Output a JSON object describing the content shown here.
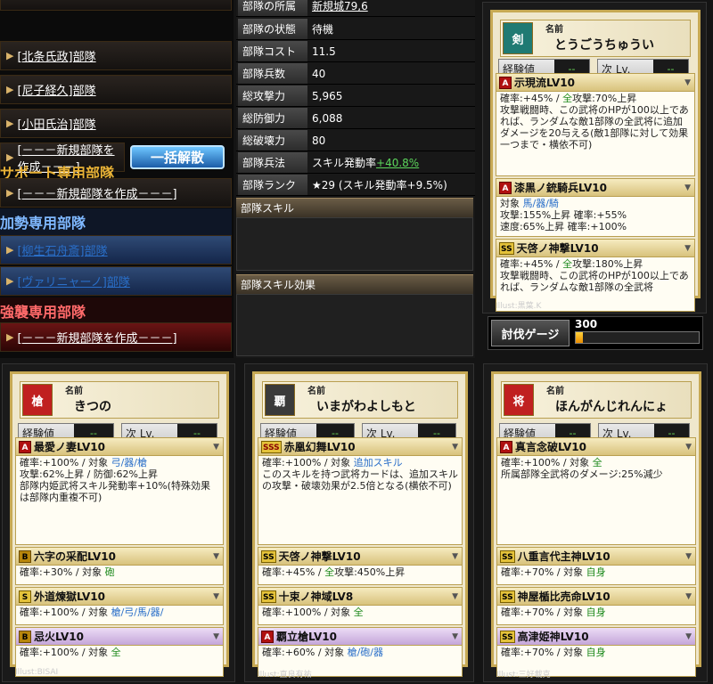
{
  "left_panel": {
    "rows_top": [
      {
        "label": "[北条氏政]部隊"
      },
      {
        "label": "[尼子経久]部隊"
      },
      {
        "label": "[小田氏治]部隊"
      },
      {
        "label": "[－－－新規部隊を作成－－－]"
      }
    ],
    "bulk_button": "一括解散",
    "support_section": "サポート専用部隊",
    "support_rows": [
      {
        "label": "[－－－新規部隊を作成－－－]"
      }
    ],
    "force_section": "加勢専用部隊",
    "force_rows": [
      {
        "label": "[柳生石舟斎]部隊"
      },
      {
        "label": "[ヴァリニャーノ]部隊"
      }
    ],
    "raid_section": "強襲専用部隊",
    "raid_rows": [
      {
        "label": "[－－－新規部隊を作成－－－]"
      }
    ]
  },
  "unit_stats": [
    {
      "label": "部隊の所属",
      "value": "新規城79,6"
    },
    {
      "label": "部隊の状態",
      "value": "待機"
    },
    {
      "label": "部隊コスト",
      "value": "11.5"
    },
    {
      "label": "部隊兵数",
      "value": "40"
    },
    {
      "label": "総攻撃力",
      "value": "5,965"
    },
    {
      "label": "総防御力",
      "value": "6,088"
    },
    {
      "label": "総破壊力",
      "value": "80"
    },
    {
      "label": "部隊兵法",
      "value": "スキル発動率",
      "extra": "+40.8%"
    },
    {
      "label": "部隊ランク",
      "value": "★29 (スキル発動率+9.5%)"
    }
  ],
  "unit_skill_header": "部隊スキル",
  "unit_skill_effect_header": "部隊スキル効果",
  "common": {
    "name_label": "名前",
    "exp_label": "経験値",
    "next_label": "次 Lv.",
    "dash": "--"
  },
  "gauge": {
    "label": "討伐ゲージ",
    "value": "300",
    "fill_percent": 6
  },
  "cards": [
    {
      "icon_char": "剣",
      "icon_color": "#1f7a73",
      "name": "とうごうちゅうい",
      "illust": "Illust:黒葉.K",
      "skills": [
        {
          "rank": "A",
          "name": "示現流LV10",
          "body_pre": "確率:+45%  /  ",
          "body_hl": "全",
          "body_post": "攻撃:70%上昇\n攻撃戦闘時、この武将のHPが100以上であれば、ランダムな敵1部隊の全武将に追加ダメージを20与える(敵1部隊に対して効果一つまで・横依不可)"
        },
        {
          "rank": "A",
          "name": "漆黒ノ銃騎兵LV10",
          "body_pre": "対象  ",
          "body_hl": "馬/器/騎",
          "body_post": "\n攻撃:155%上昇  確率:+55%\n速度:65%上昇  確率:+100%"
        },
        {
          "rank": "SS",
          "name": "天啓ノ神撃LV10",
          "body_pre": "確率:+45%  /  ",
          "body_hl": "全",
          "body_post": "攻撃:180%上昇\n攻撃戦闘時、この武将のHPが100以上であれば、ランダムな敵1部隊の全武将"
        }
      ]
    },
    {
      "icon_char": "槍",
      "icon_color": "#c02020",
      "name": "きつの",
      "illust": "Illust:BISAI",
      "skills": [
        {
          "rank": "A",
          "name": "最愛ノ妻LV10",
          "body_pre": "確率:+100%  /  対象  ",
          "body_hl": "弓/器/槍",
          "body_post": "\n攻撃:62%上昇 / 防御:62%上昇\n部隊内姫武将スキル発動率+10%(特殊効果は部隊内重複不可)"
        },
        {
          "rank": "B",
          "name": "六字の采配LV10",
          "body_pre": "確率:+30%  /  対象  ",
          "body_hl": "砲",
          "body_post": ""
        },
        {
          "rank": "S",
          "name": "外道煉獄LV10",
          "body_pre": "確率:+100%  /  対象  ",
          "body_hl": "槍/弓/馬/器/",
          "body_post": ""
        },
        {
          "rank": "B",
          "name": "忌火LV10",
          "body_pre": "確率:+100%  /  対象  ",
          "body_hl": "全",
          "body_post": "",
          "purple": true
        }
      ]
    },
    {
      "icon_char": "覇",
      "icon_color": "#3a3a3a",
      "name": "いまがわよしもと",
      "illust": "Illust:直良有祐",
      "skills": [
        {
          "rank": "SSS",
          "name": "赤凰幻舞LV10",
          "body_pre": "確率:+100%  /  対象  ",
          "body_hl": "追加スキル",
          "body_post": "\nこのスキルを持つ武将カードは、追加スキルの攻撃・破壊効果が2.5倍となる(横依不可)"
        },
        {
          "rank": "SS",
          "name": "天啓ノ神撃LV10",
          "body_pre": "確率:+45%  /  ",
          "body_hl": "全",
          "body_post": "攻撃:450%上昇"
        },
        {
          "rank": "SS",
          "name": "十束ノ神域LV8",
          "body_pre": "確率:+100%  /  対象  ",
          "body_hl": "全",
          "body_post": ""
        },
        {
          "rank": "A",
          "name": "覇立槍LV10",
          "body_pre": "確率:+60%  /  対象  ",
          "body_hl": "槍/砲/器",
          "body_post": "",
          "purple": true
        }
      ]
    },
    {
      "icon_char": "将",
      "icon_color": "#c02020",
      "name": "ほんがんじれんにょ",
      "illust": "Illust:三好載克",
      "skills": [
        {
          "rank": "A",
          "name": "真言念破LV10",
          "body_pre": "確率:+100%  /  対象  ",
          "body_hl": "全",
          "body_post": "\n所属部隊全武将のダメージ:25%減少"
        },
        {
          "rank": "SS",
          "name": "八重言代主神LV10",
          "body_pre": "確率:+70%  /  対象  ",
          "body_hl": "自身",
          "body_post": ""
        },
        {
          "rank": "SS",
          "name": "神屋楯比売命LV10",
          "body_pre": "確率:+70%  /  対象  ",
          "body_hl": "自身",
          "body_post": ""
        },
        {
          "rank": "SS",
          "name": "高津姫神LV10",
          "body_pre": "確率:+70%  /  対象  ",
          "body_hl": "自身",
          "body_post": "",
          "purple": true
        }
      ]
    }
  ]
}
